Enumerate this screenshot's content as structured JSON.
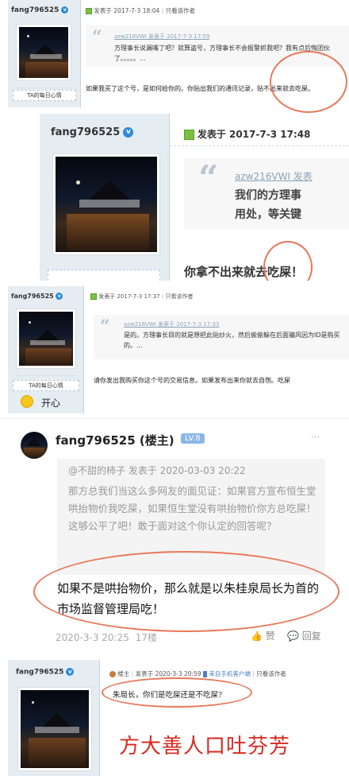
{
  "panel1": {
    "username": "fang796525",
    "ta_label": "TA的每日心情",
    "post_meta": "发表于 2017-7-3 18:04",
    "only_author": "只看该作者",
    "quote_head": "azw216VWI 发表于 2017-7-3 17:59",
    "quote_body": "方理事长说漏嘴了吧？就算盗号，方理事长不会报警抓我吧？我有点后悔团伙了。。。。。...",
    "reply": "如果我买了这个号，是如何给你的。你贴出我们的通讯记录，贴不出来就去吃屎。"
  },
  "panel2": {
    "username": "fang796525",
    "post_meta": "发表于 2017-7-3 17:48",
    "quote_head": "azw216VWI 发表",
    "quote_body_1": "我们的方理事",
    "quote_body_2": "用处，等关键",
    "reply": "你拿不出来就去吃屎！"
  },
  "panel3": {
    "username": "fang796525",
    "ta_label": "TA的每日心情",
    "mood": "开心",
    "post_meta": "发表于 2017-7-3 17:37",
    "only_author": "只看该作者",
    "quote_head": "azw216VWI 发表于 2017-7-3 17:33",
    "quote_body": "是的。方理事长目的就是想把此贴炒火，然后偷偷躲在后面骗风因为ID是购买的。...",
    "reply": "请你发出我购买你这个号的交易信息。如果发布出来你就去自刎。吃屎"
  },
  "panel4": {
    "username": "fang796525 (楼主)",
    "level": "LV.8",
    "more": "···",
    "quote_head": "@不甜的柿子 发表于 2020-03-03 20:22",
    "quote_body": "那方总我们当这么多网友的面见证：如果官方宣布恒生堂哄抬物价我吃屎，如果恒生堂没有哄抬物价你方总吃屎！这够公平了吧！敢于面对这个你认定的回答呢？",
    "reply": "如果不是哄抬物价，那么就是以朱桂泉局长为首的市场监督管理局吃！",
    "timestamp": "2020-3-3 20:25",
    "floor": "17楼",
    "like": "赞",
    "reply_btn": "回复"
  },
  "panel5": {
    "role": "楼主",
    "post_meta": "发表于 2020-3-3 20:59",
    "client": "来自手机客户端",
    "only_author": "只看该作者",
    "reply": "朱局长，你们是吃屎还是不吃屎?"
  },
  "caption": "方大善人口吐芬芳",
  "colors": {
    "accent_circle": "#e8785a",
    "caption_red": "#d9281e",
    "link_blue": "#8ba2b8",
    "level_badge": "#8ab6e6"
  }
}
